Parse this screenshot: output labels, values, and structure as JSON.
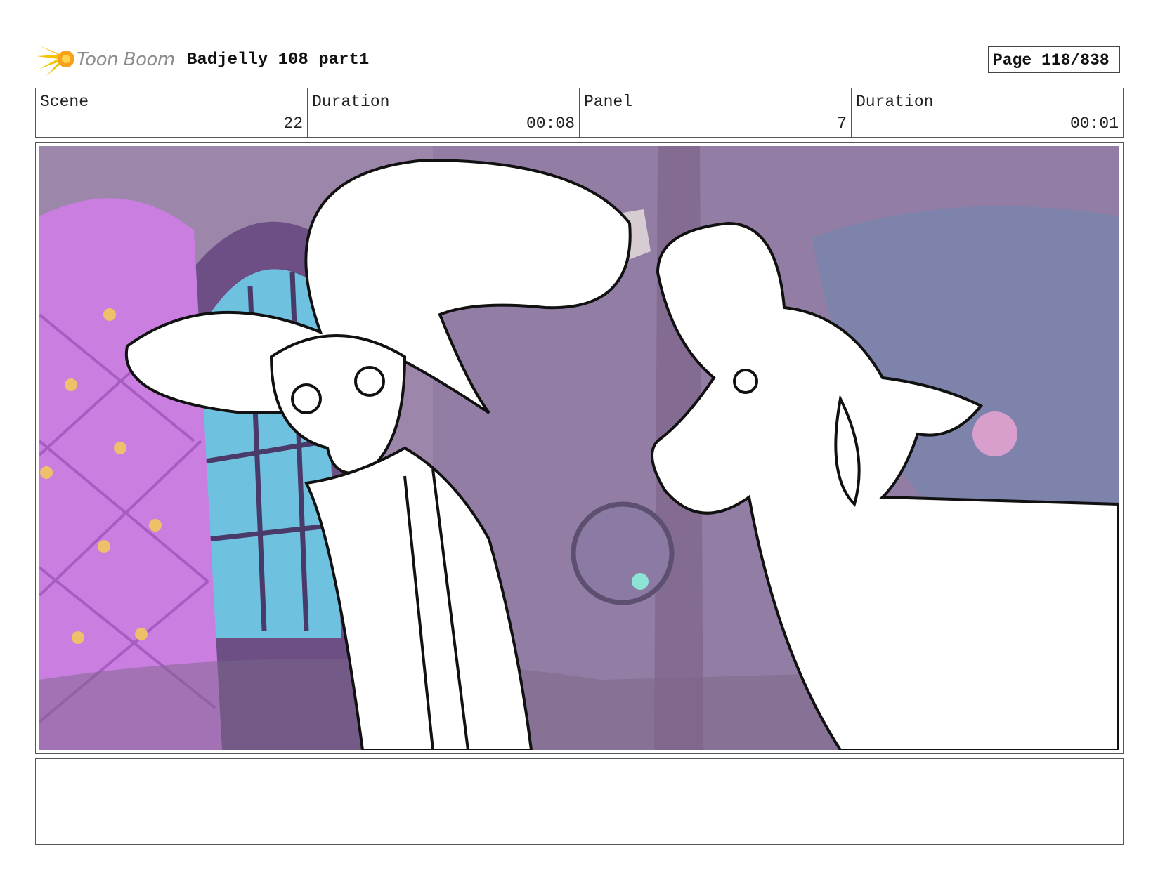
{
  "header": {
    "logo_text": "Toon Boom",
    "project_title": "Badjelly 108 part1",
    "page_label": "Page 118/838"
  },
  "info": {
    "scene_label": "Scene",
    "scene_value": "22",
    "scene_duration_label": "Duration",
    "scene_duration_value": "00:08",
    "panel_label": "Panel",
    "panel_value": "7",
    "panel_duration_label": "Duration",
    "panel_duration_value": "00:01"
  },
  "colors": {
    "background_purple": "#9c86aa",
    "throne_magenta": "#c97ee0",
    "stained_glass_cyan": "#6fd6ee",
    "button_gold": "#f0bf6a",
    "line_black": "#111111"
  },
  "notes": {
    "text": ""
  }
}
